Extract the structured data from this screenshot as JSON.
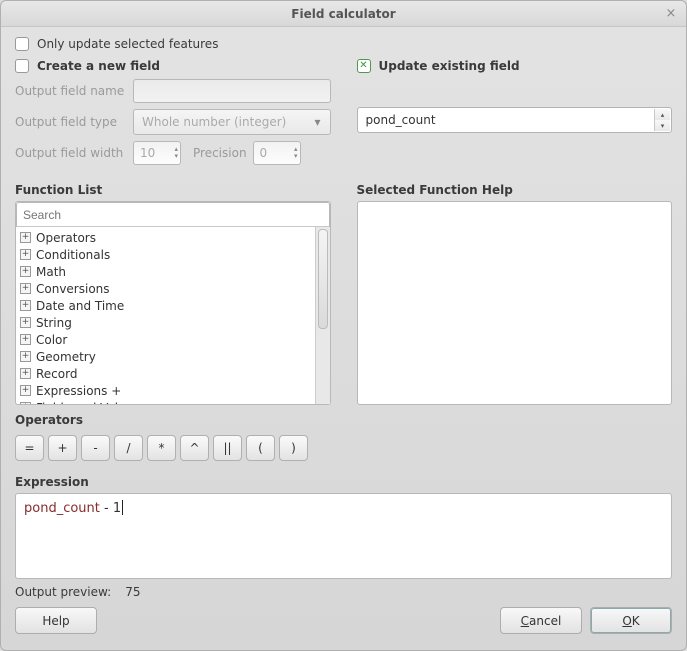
{
  "window": {
    "title": "Field calculator"
  },
  "checkboxes": {
    "only_update_selected": "Only update selected features",
    "create_new_field": "Create a new field",
    "update_existing_field": "Update existing field"
  },
  "new_field": {
    "name_label": "Output field name",
    "type_label": "Output field type",
    "type_value": "Whole number (integer)",
    "width_label": "Output field width",
    "width_value": "10",
    "precision_label": "Precision",
    "precision_value": "0"
  },
  "update_field": {
    "selected": "pond_count"
  },
  "sections": {
    "function_list": "Function List",
    "help": "Selected Function Help",
    "operators": "Operators",
    "expression": "Expression"
  },
  "search": {
    "placeholder": "Search"
  },
  "functions": [
    "Operators",
    "Conditionals",
    "Math",
    "Conversions",
    "Date and Time",
    "String",
    "Color",
    "Geometry",
    "Record",
    "Expressions +",
    "Fields and Values"
  ],
  "operators": [
    "=",
    "+",
    "-",
    "/",
    "*",
    "^",
    "||",
    "(",
    ")"
  ],
  "expression": {
    "field": "pond_count",
    "rest": " - 1"
  },
  "preview": {
    "label": "Output preview:",
    "value": "75"
  },
  "buttons": {
    "help": "Help",
    "cancel": "Cancel",
    "ok": "OK"
  }
}
